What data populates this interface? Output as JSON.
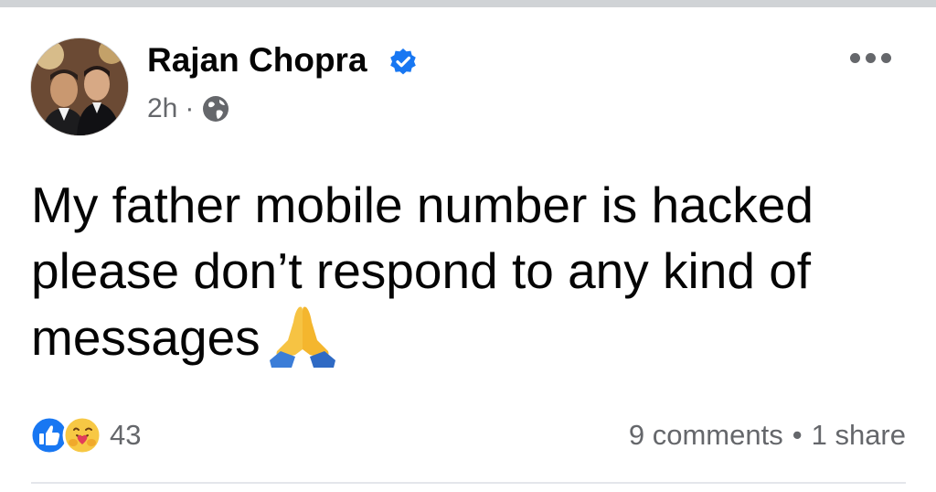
{
  "post": {
    "author": "Rajan Chopra",
    "time": "2h",
    "meta_separator": "·",
    "audience_icon": "globe-icon",
    "verified_icon": "verified-badge-icon",
    "body_text": "My father mobile number is hacked please don’t respond to any kind of messages",
    "emoji": "folded-hands",
    "more_icon": "more-options-icon"
  },
  "footer": {
    "reactions": [
      "like",
      "care"
    ],
    "reaction_count": "43",
    "comments": "9 comments",
    "separator": "•",
    "shares": "1 share"
  },
  "colors": {
    "text": "#050505",
    "secondary": "#65676b",
    "verified": "#1877f2",
    "divider": "#e4e6eb"
  }
}
